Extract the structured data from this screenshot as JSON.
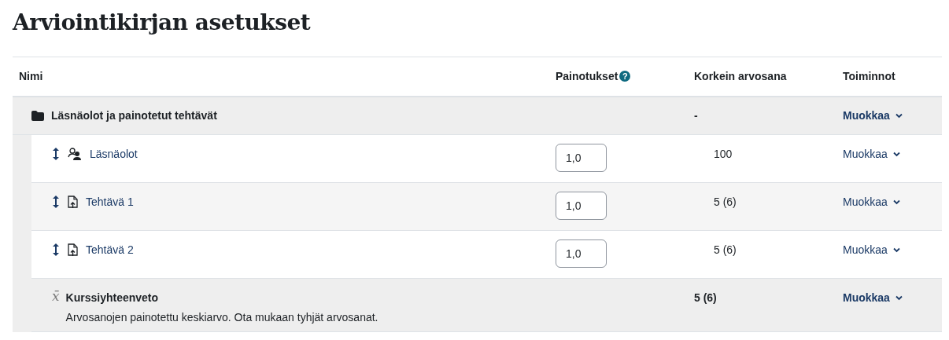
{
  "title": "Arviointikirjan asetukset",
  "table": {
    "columns": [
      {
        "label": "Nimi"
      },
      {
        "label": "Painotukset",
        "help": "?"
      },
      {
        "label": "Korkein arvosana"
      },
      {
        "label": "Toiminnot"
      }
    ],
    "rows": [
      {
        "kind": "category",
        "name": "Läsnäolot ja painotetut tehtävät",
        "max_grade": "-",
        "action": "Muokkaa"
      },
      {
        "kind": "attendance",
        "name": "Läsnäolot",
        "weight": "1,0",
        "max_grade": "100",
        "action": "Muokkaa"
      },
      {
        "kind": "assignment",
        "name": "Tehtävä 1",
        "weight": "1,0",
        "max_grade": "5 (6)",
        "action": "Muokkaa"
      },
      {
        "kind": "assignment",
        "name": "Tehtävä 2",
        "weight": "1,0",
        "max_grade": "5 (6)",
        "action": "Muokkaa"
      },
      {
        "kind": "total",
        "icon_text": "x̄",
        "name": "Kurssiyhteenveto",
        "description": "Arvosanojen painotettu keskiarvo. Ota mukaan tyhjät arvosanat.",
        "max_grade": "5 (6)",
        "action": "Muokkaa"
      }
    ]
  }
}
